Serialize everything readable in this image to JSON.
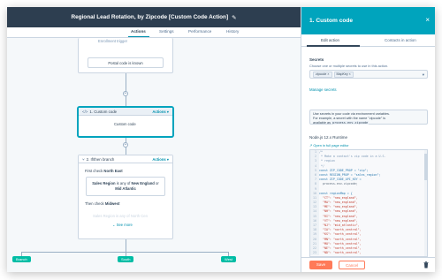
{
  "header": {
    "title": "Regional Lead Rotation, by Zipcode [Custom Code Action]",
    "tabs": [
      "Actions",
      "Settings",
      "Performance",
      "History"
    ],
    "active_tab": "Actions"
  },
  "canvas": {
    "trigger_card": {
      "header": "Enrollment trigger",
      "criteria": "Postal code is known"
    },
    "custom_code_card": {
      "header": "1. Custom code",
      "actions": "Actions",
      "body": "Custom code"
    },
    "branch_card": {
      "header": "2. If/then branch",
      "actions": "Actions",
      "first_check": "First check",
      "first_region": "North East",
      "criteria_part1": "Sales Region",
      "criteria_part2": "is any of",
      "criteria_value1": "New England",
      "criteria_or": "or",
      "criteria_value2": "Mid Atlantic",
      "then_check": "Then check",
      "second_region": "Midwest",
      "faded_criteria": "Sales Region is any of North Cen",
      "see_more": "See more"
    },
    "branches": [
      "Branch",
      "South",
      "West"
    ],
    "plus_symbol": "+"
  },
  "panel": {
    "title": "1. Custom code",
    "close_symbol": "×",
    "tabs": [
      "Edit action",
      "Contacts in action"
    ],
    "secrets_label": "Secrets",
    "secrets_help": "Choose one or multiple secrets to use in this action.",
    "secret_chips": [
      "zipcode",
      "MapKey"
    ],
    "manage_secrets": "Manage secrets",
    "info_text_1": "Use secrets in your code via environment variables.",
    "info_text_2": "For example, a secret with the name \"zipcode\" is",
    "info_text_3": "available as",
    "info_code": "process.env.zipcode",
    "runtime_label": "Node.js 12.x Runtime",
    "open_editor": "Open in full page editor",
    "code_lines": [
      {
        "n": "1",
        "t": "/*",
        "c": "cm"
      },
      {
        "n": "2",
        "t": " * Make a contact's zip code in a U.S.",
        "c": "cm"
      },
      {
        "n": "3",
        "t": " * region",
        "c": "cm"
      },
      {
        "n": "4",
        "t": " */",
        "c": "cm"
      },
      {
        "n": "5",
        "t": "const ZIP_CODE_PROP = \"zip\";",
        "c": "kw"
      },
      {
        "n": "6",
        "t": "const REGION_PROP = \"sales_region\";",
        "c": "kw"
      },
      {
        "n": "7",
        "t": "const ZIP_CODE_API_KEY =",
        "c": "kw"
      },
      {
        "n": "8",
        "t": "  process.env.zipcode;",
        "c": ""
      },
      {
        "n": "9",
        "t": "",
        "c": ""
      },
      {
        "n": "10",
        "t": "const regionMap = {",
        "c": "kw"
      },
      {
        "n": "11",
        "t": "  \"CT\": \"new_england\",",
        "c": "str"
      },
      {
        "n": "12",
        "t": "  \"MA\": \"new_england\",",
        "c": "str"
      },
      {
        "n": "13",
        "t": "  \"ME\": \"new_england\",",
        "c": "str"
      },
      {
        "n": "14",
        "t": "  \"NH\": \"new_england\",",
        "c": "str"
      },
      {
        "n": "15",
        "t": "  \"RI\": \"new_england\",",
        "c": "str"
      },
      {
        "n": "16",
        "t": "  \"VT\": \"new_england\",",
        "c": "str"
      },
      {
        "n": "17",
        "t": "  \"NJ\": \"mid_atlantic\",",
        "c": "str"
      },
      {
        "n": "18",
        "t": "  \"IA\": \"north_central\",",
        "c": "str"
      },
      {
        "n": "19",
        "t": "  \"KS\": \"north_central\",",
        "c": "str"
      },
      {
        "n": "20",
        "t": "  \"MN\": \"north_central\",",
        "c": "str"
      },
      {
        "n": "21",
        "t": "  \"MO\": \"north_central\",",
        "c": "str"
      },
      {
        "n": "22",
        "t": "  \"NE\": \"north_central\",",
        "c": "str"
      },
      {
        "n": "23",
        "t": "  \"ND\": \"north_central\",",
        "c": "str"
      }
    ],
    "save_label": "Save",
    "cancel_label": "Cancel"
  },
  "colors": {
    "header_bg": "#2d3e50",
    "panel_accent": "#00a4bd",
    "branch_green": "#00bda5",
    "save_orange": "#ff7a59",
    "link": "#0091ae"
  }
}
